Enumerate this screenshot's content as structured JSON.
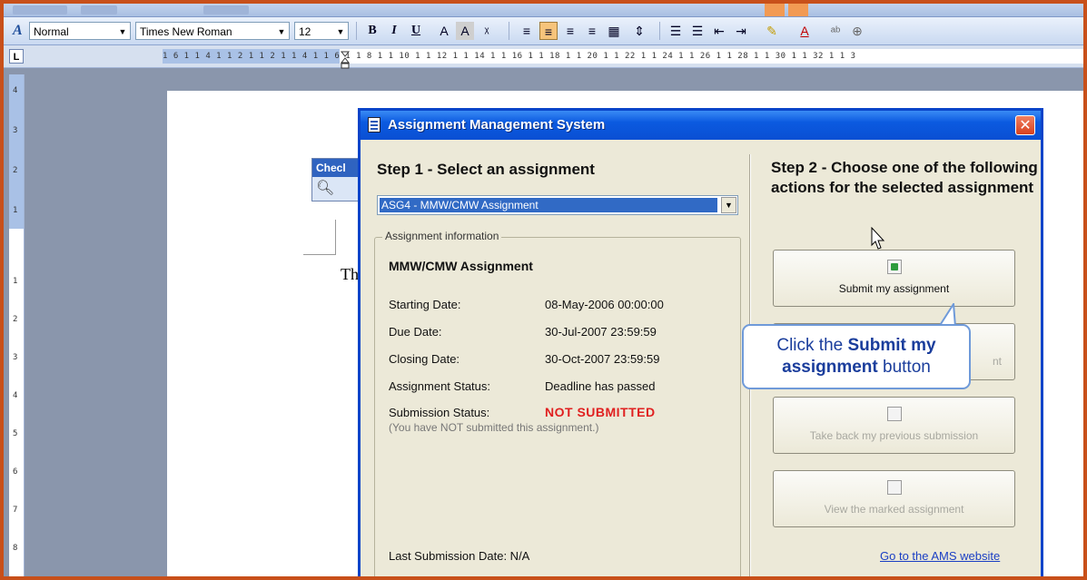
{
  "toolbar": {
    "style_value": "Normal",
    "font_value": "Times New Roman",
    "size_value": "12",
    "bold_label": "B",
    "italic_label": "I",
    "underline_label": "U"
  },
  "ruler": {
    "corner_label": "L",
    "ticks": "1 6 1   1 4 1   1 2 1        1 2 1    1 4 1    1 6 1    1 8 1   1 10 1   1 12 1   1 14 1   1 16 1   1 18 1   1 20 1   1 22 1   1 24 1   1 26 1   1 28 1   1 30 1   1 32 1   1 3"
  },
  "document": {
    "text": "Th",
    "widget_title": "Checl"
  },
  "dialog": {
    "title": "Assignment Management System",
    "close_label": "✕",
    "step1_heading": "Step 1 - Select an assignment",
    "selected_assignment": "ASG4 - MMW/CMW Assignment",
    "group_legend": "Assignment information",
    "info_title": "MMW/CMW Assignment",
    "fields": [
      {
        "label": "Starting Date:",
        "value": "08-May-2006 00:00:00"
      },
      {
        "label": "Due Date:",
        "value": "30-Jul-2007 23:59:59"
      },
      {
        "label": "Closing Date:",
        "value": "30-Oct-2007 23:59:59"
      },
      {
        "label": "Assignment Status:",
        "value": "Deadline has passed"
      },
      {
        "label": "Submission Status:",
        "value": "NOT SUBMITTED"
      }
    ],
    "submission_note": "(You have NOT submitted this assignment.)",
    "last_submission": "Last Submission Date:  N/A",
    "step2_heading": "Step 2 - Choose one of the following actions for the selected assignment",
    "actions": [
      {
        "label": "Submit my assignment",
        "enabled": true
      },
      {
        "label": "nt",
        "enabled": false
      },
      {
        "label": "Take back my previous submission",
        "enabled": false
      },
      {
        "label": "View the marked assignment",
        "enabled": false
      }
    ],
    "ams_link": "Go to the AMS website"
  },
  "callout": {
    "prefix": "Click the",
    "strong": "Submit my assignment",
    "suffix": "button"
  },
  "colors": {
    "frame_border": "#c8501a",
    "titlebar": "#0b5ae0",
    "alert": "#e02020",
    "link": "#1b3fc4"
  }
}
